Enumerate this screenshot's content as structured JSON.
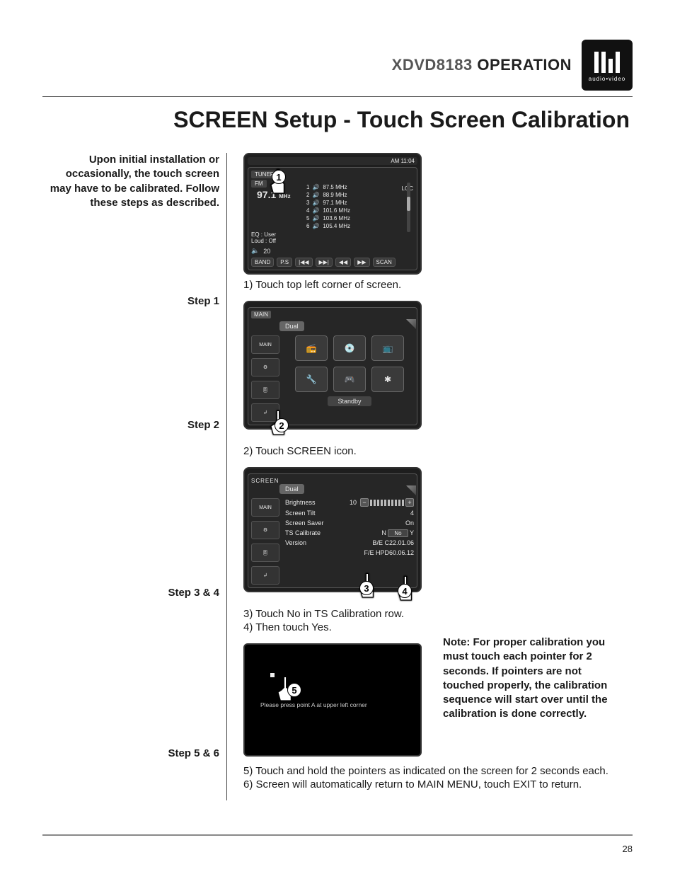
{
  "header": {
    "model": "XDVD8183",
    "section": "OPERATION",
    "logo_sub": "audio•video"
  },
  "page_title": "SCREEN Setup - Touch Screen Calibration",
  "intro": "Upon initial installation or occasionally, the touch screen may have to be calibrated. Follow these steps as described.",
  "labels": {
    "step1": "Step 1",
    "step2": "Step 2",
    "step34": "Step 3 & 4",
    "step56": "Step 5 & 6"
  },
  "instructions": {
    "s1": "1) Touch top left corner of screen.",
    "s2": "2) Touch SCREEN icon.",
    "s3": "3) Touch No in TS Calibration row.",
    "s4": "4) Then touch Yes.",
    "s5": "5) Touch and hold the pointers as indicated on the screen for 2 seconds each.",
    "s6": "6) Screen will automatically return to MAIN MENU, touch EXIT to return."
  },
  "note": "Note: For proper calibration you must touch each pointer for 2 seconds. If pointers are not touched properly, the calibration sequence will start over until the calibration is done correctly.",
  "page_number": "28",
  "shot1": {
    "clock": "AM 11:04",
    "band": "FM",
    "freq": "97.1",
    "unit": "MHz",
    "loc": "LOC",
    "eq": "EQ  : User",
    "loud": "Loud : Off",
    "vol": "20",
    "presets": [
      {
        "n": "1",
        "f": "87.5 MHz"
      },
      {
        "n": "2",
        "f": "88.9 MHz"
      },
      {
        "n": "3",
        "f": "97.1 MHz"
      },
      {
        "n": "4",
        "f": "101.6 MHz"
      },
      {
        "n": "5",
        "f": "103.6 MHz"
      },
      {
        "n": "6",
        "f": "105.4 MHz"
      }
    ],
    "buttons": [
      "BAND",
      "P.S",
      "|◀◀",
      "▶▶|",
      "◀◀",
      "▶▶",
      "SCAN"
    ],
    "tuner_label": "TUNER"
  },
  "shot2": {
    "main": "MAIN",
    "brand": "Dual",
    "standby": "Standby",
    "tiles": [
      "📻",
      "💿",
      "📺",
      "🔧",
      "🎮",
      "✱"
    ]
  },
  "shot3": {
    "title": "SCREEN",
    "brand": "Dual",
    "main": "MAIN",
    "rows": {
      "brightness_l": "Brightness",
      "brightness_v": "10",
      "tilt_l": "Screen Tilt",
      "tilt_v": "4",
      "saver_l": "Screen Saver",
      "saver_v": "On",
      "cal_l": "TS Calibrate",
      "cal_n": "N",
      "cal_no": "No",
      "cal_y": "Y",
      "ver_l": "Version",
      "ver_be": "B/E  C22.01.06",
      "ver_fe": "F/E  HPD60.06.12"
    }
  },
  "shot4": {
    "msg": "Please press point A at upper left corner"
  },
  "callouts": {
    "c1": "1",
    "c2": "2",
    "c3": "3",
    "c4": "4",
    "c5": "5"
  }
}
